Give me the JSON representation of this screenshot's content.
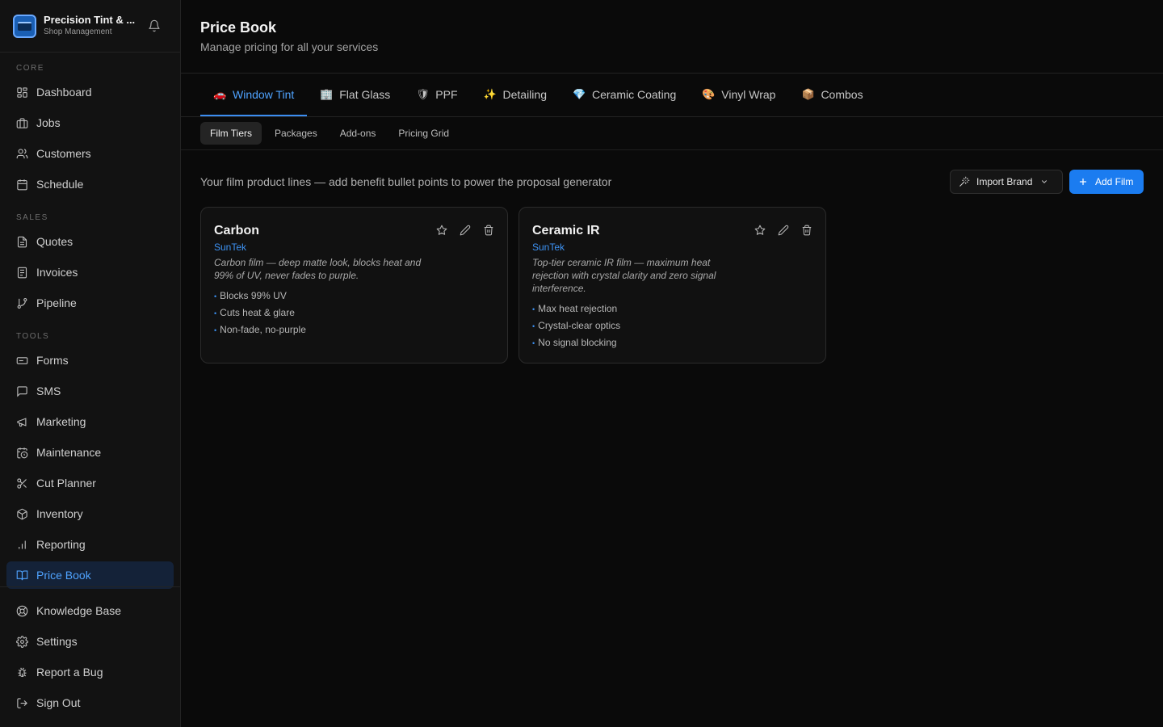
{
  "brand": {
    "name": "Precision Tint & ...",
    "subtitle": "Shop Management"
  },
  "sidebar": {
    "sections": {
      "core": "CORE",
      "sales": "SALES",
      "tools": "TOOLS"
    },
    "items": {
      "dashboard": "Dashboard",
      "jobs": "Jobs",
      "customers": "Customers",
      "schedule": "Schedule",
      "quotes": "Quotes",
      "invoices": "Invoices",
      "pipeline": "Pipeline",
      "forms": "Forms",
      "sms": "SMS",
      "marketing": "Marketing",
      "maintenance": "Maintenance",
      "cut_planner": "Cut Planner",
      "inventory": "Inventory",
      "reporting": "Reporting",
      "price_book": "Price Book",
      "knowledge_base": "Knowledge Base",
      "settings": "Settings",
      "report_bug": "Report a Bug",
      "sign_out": "Sign Out"
    }
  },
  "page": {
    "title": "Price Book",
    "subtitle": "Manage pricing for all your services"
  },
  "tabs": [
    {
      "emoji": "🚗",
      "label": "Window Tint"
    },
    {
      "emoji": "🏢",
      "label": "Flat Glass"
    },
    {
      "emoji": "🛡",
      "label": "PPF"
    },
    {
      "emoji": "✨",
      "label": "Detailing"
    },
    {
      "emoji": "💎",
      "label": "Ceramic Coating"
    },
    {
      "emoji": "🎨",
      "label": "Vinyl Wrap"
    },
    {
      "emoji": "📦",
      "label": "Combos"
    }
  ],
  "subtabs": [
    "Film Tiers",
    "Packages",
    "Add-ons",
    "Pricing Grid"
  ],
  "toolbar": {
    "description": "Your film product lines — add benefit bullet points to power the proposal generator",
    "import_label": "Import Brand",
    "add_label": "Add Film"
  },
  "cards": [
    {
      "title": "Carbon",
      "brand": "SunTek",
      "description": "Carbon film — deep matte look, blocks heat and 99% of UV, never fades to purple.",
      "bullets": [
        "Blocks 99% UV",
        "Cuts heat & glare",
        "Non-fade, no-purple"
      ]
    },
    {
      "title": "Ceramic IR",
      "brand": "SunTek",
      "description": "Top-tier ceramic IR film — maximum heat rejection with crystal clarity and zero signal interference.",
      "bullets": [
        "Max heat rejection",
        "Crystal-clear optics",
        "No signal blocking"
      ]
    }
  ],
  "colors": {
    "accent": "#1b7cf0",
    "active_nav_bg": "#142238",
    "background": "#0a0a0a"
  }
}
